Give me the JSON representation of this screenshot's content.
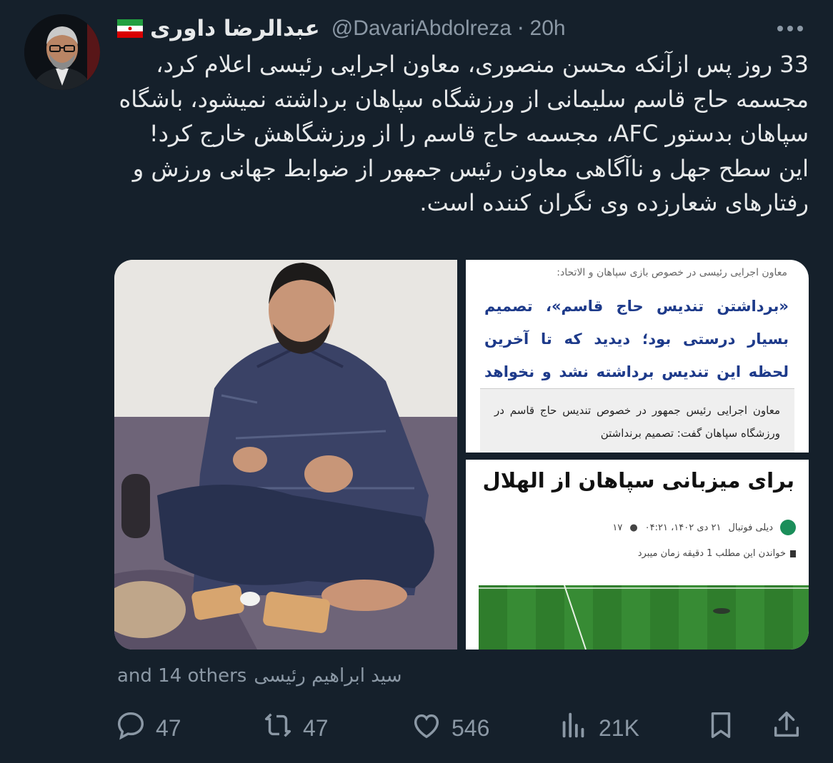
{
  "author": {
    "name": "عبدالرضا داوری",
    "flag_icon": "iran-flag-icon",
    "handle": "@DavariAbdolreza",
    "separator": "·",
    "time": "20h"
  },
  "tweet": {
    "paragraph1": "33 روز پس ازآنکه محسن منصوری، معاون اجرایی رئیسی اعلام کرد، مجسمه حاج قاسم سلیمانی از ورزشگاه سپاهان برداشته نمیشود، باشگاه سپاهان بدستور AFC، مجسمه حاج قاسم را از ورزشگاهش خارج کرد!",
    "paragraph2": "این سطح جهل و ناآگاهی معاون رئیس جمهور از ضوابط جهانی ورزش و رفتارهای شعارزده وی نگران کننده است."
  },
  "media": {
    "card1": {
      "subtitle": "معاون اجرایی رئیسی در خصوص بازی سپاهان و الاتحاد:",
      "quote": "«برداشتن تندیس حاج قاسم»، تصمیم بسیار درستی بود؛ دیدید که تا آخرین لحظه این تندیس برداشته نشد و نخواهد شد",
      "body": "معاون اجرایی رئیس جمهور در خصوص تندیس حاج قاسم در ورزشگاه سپاهان گفت: تصمیم برنداشتن"
    },
    "card2": {
      "title": "برای میزبانی سپاهان از الهلال",
      "source": "دیلی فوتبال",
      "date": "۲۱ دی ۱۴۰۲، ۰۴:۲۱",
      "comments": "۱۷",
      "read_time": "خواندن این مطلب 1 دقیقه زمان میبرد"
    }
  },
  "tagged": {
    "person": "سید ابراهیم رئیسی",
    "others": "and 14 others"
  },
  "actions": {
    "replies": "47",
    "retweets": "47",
    "likes": "546",
    "views": "21K"
  },
  "icons": [
    "reply-icon",
    "retweet-icon",
    "like-icon",
    "views-icon",
    "bookmark-icon",
    "share-icon",
    "more-icon"
  ],
  "colors": {
    "background": "#15202b",
    "text": "#e7e9ea",
    "muted": "#8b98a5"
  }
}
